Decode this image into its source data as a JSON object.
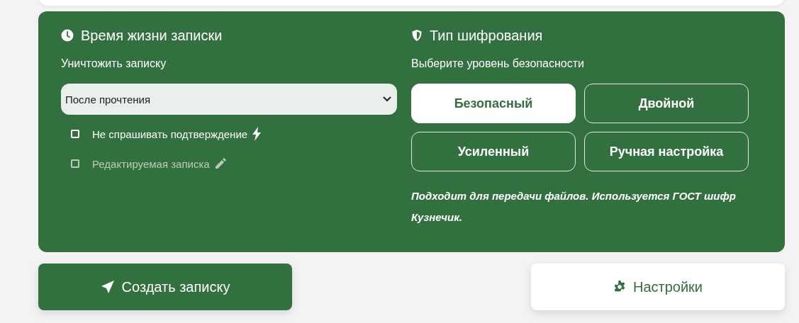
{
  "lifetime": {
    "title": "Время жизни записки",
    "label": "Уничтожить записку",
    "select": {
      "value": "После прочтения"
    },
    "options": [
      {
        "label": "Не спрашивать подтверждение",
        "checked": false,
        "disabled": false
      },
      {
        "label": "Редактируемая записка",
        "checked": false,
        "disabled": true
      }
    ]
  },
  "encryption": {
    "title": "Тип шифрования",
    "label": "Выберите уровень безопасности",
    "levels": [
      {
        "label": "Безопасный",
        "selected": true
      },
      {
        "label": "Двойной",
        "selected": false
      },
      {
        "label": "Усиленный",
        "selected": false
      },
      {
        "label": "Ручная настройка",
        "selected": false
      }
    ],
    "description": "Подходит для передачи файлов. Используется ГОСТ шифр Кузнечик."
  },
  "actions": [
    {
      "label": "Создать записку",
      "kind": "primary"
    },
    {
      "label": "Настройки",
      "kind": "secondary"
    }
  ]
}
